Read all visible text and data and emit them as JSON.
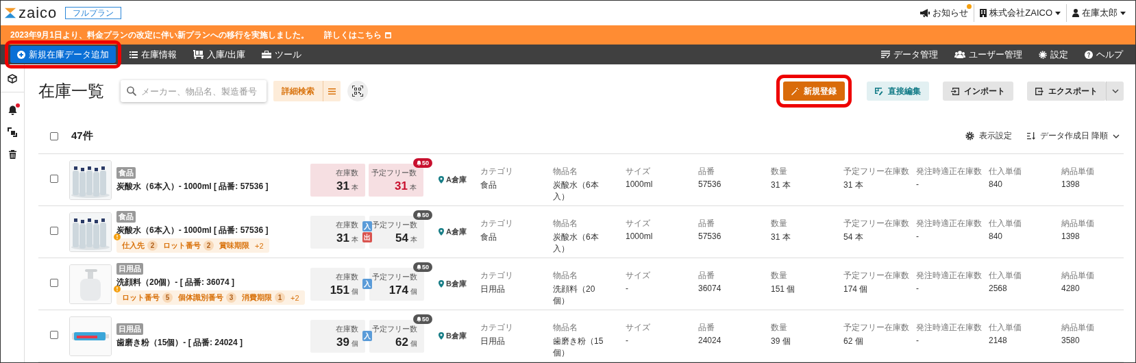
{
  "header": {
    "logo": "zaico",
    "plan_badge": "フルプラン",
    "notice": {
      "label": "お知らせ",
      "unread": true
    },
    "company": "株式会社ZAICO",
    "user": "在庫太郎"
  },
  "banner": {
    "message": "2023年9月1日より、料金プランの改定に伴い新プランへの移行を実施しました。",
    "link": "詳しくはこちら"
  },
  "nav": {
    "add_button": {
      "label": "新規在庫データ追加",
      "highlighted": true
    },
    "left_items": [
      "在庫情報",
      "入庫/出庫",
      "ツール"
    ],
    "right_items": [
      "データ管理",
      "ユーザー管理",
      "設定",
      "ヘルプ"
    ]
  },
  "sidebar": {
    "notifications_unread": true
  },
  "page": {
    "title": "在庫一覧",
    "search": {
      "placeholder": "メーカー、物品名、製造番号"
    },
    "advanced_search": "詳細検索",
    "actions": [
      {
        "label": "新規登録",
        "kind": "primary",
        "highlighted": true
      },
      {
        "label": "直接編集",
        "kind": "secondary",
        "highlighted": false
      },
      {
        "label": "インポート",
        "kind": "default",
        "highlighted": false
      },
      {
        "label": "エクスポート",
        "kind": "split",
        "highlighted": false
      }
    ]
  },
  "list_header": {
    "select_all_checked": false,
    "count": "47件",
    "display_settings": "表示設定",
    "sort": "データ作成日 降順"
  },
  "rows": [
    {
      "checked": false,
      "image": {
        "kind": "picture"
      },
      "category_tag": "食品",
      "title": "炭酸水（6本入）- 1000ml [ 品番: 57536 ]",
      "warnings": [],
      "alert": true,
      "stock": {
        "label": "在庫数",
        "value": "31",
        "unit": "本"
      },
      "free_stock": {
        "label": "予定フリー数",
        "value": "31",
        "unit": "本"
      },
      "badge": "50",
      "io_tags": [],
      "location": "A倉庫",
      "fields": [
        {
          "label": "カテゴリ",
          "value": "食品"
        },
        {
          "label": "物品名",
          "value": "炭酸水（6本入）"
        },
        {
          "label": "サイズ",
          "value": "1000ml"
        },
        {
          "label": "品番",
          "value": "57536"
        },
        {
          "label": "数量",
          "value": "31 本"
        },
        {
          "label": "予定フリー在庫数",
          "value": "31 本"
        },
        {
          "label": "発注時適正在庫数",
          "value": "-"
        },
        {
          "label": "仕入単価",
          "value": "840"
        },
        {
          "label": "納品単価",
          "value": "1398"
        }
      ]
    },
    {
      "checked": false,
      "image": {
        "kind": "picture"
      },
      "category_tag": "食品",
      "title": "炭酸水（6本入）- 1000ml [ 品番: 57536 ]",
      "warnings": [
        {
          "label": "仕入先",
          "count": "2"
        },
        {
          "label": "ロット番号",
          "count": "2"
        },
        {
          "label": "賞味期限"
        }
      ],
      "more": "+2",
      "alert": false,
      "stock": {
        "label": "在庫数",
        "value": "31",
        "unit": "本"
      },
      "free_stock": {
        "label": "予定フリー数",
        "value": "54",
        "unit": "本"
      },
      "badge": "50",
      "io_tags": [
        {
          "label": "入",
          "kind": "in"
        },
        {
          "label": "出",
          "kind": "out"
        }
      ],
      "location": "A倉庫",
      "fields": [
        {
          "label": "カテゴリ",
          "value": "食品"
        },
        {
          "label": "物品名",
          "value": "炭酸水（6本入）"
        },
        {
          "label": "サイズ",
          "value": "1000ml"
        },
        {
          "label": "品番",
          "value": "57536"
        },
        {
          "label": "数量",
          "value": "31 本"
        },
        {
          "label": "予定フリー在庫数",
          "value": "54 本"
        },
        {
          "label": "発注時適正在庫数",
          "value": "-"
        },
        {
          "label": "仕入単価",
          "value": "840"
        },
        {
          "label": "納品単価",
          "value": "1398"
        }
      ]
    },
    {
      "checked": false,
      "image": {
        "kind": "picture"
      },
      "category_tag": "日用品",
      "title": "洗顔料（20個）- [ 品番: 36074 ]",
      "warnings": [
        {
          "label": "ロット番号",
          "count": "5"
        },
        {
          "label": "個体識別番号",
          "count": "3"
        },
        {
          "label": "消費期限",
          "count": "1"
        }
      ],
      "more": "+2",
      "alert": false,
      "stock": {
        "label": "在庫数",
        "value": "151",
        "unit": "個"
      },
      "free_stock": {
        "label": "予定フリー数",
        "value": "174",
        "unit": "個"
      },
      "badge": "50",
      "io_tags": [
        {
          "label": "入",
          "kind": "in"
        }
      ],
      "location": "B倉庫",
      "fields": [
        {
          "label": "カテゴリ",
          "value": "日用品"
        },
        {
          "label": "物品名",
          "value": "洗顔料（20個）"
        },
        {
          "label": "サイズ",
          "value": "-"
        },
        {
          "label": "品番",
          "value": "36074"
        },
        {
          "label": "数量",
          "value": "151 個"
        },
        {
          "label": "予定フリー在庫数",
          "value": "174 個"
        },
        {
          "label": "発注時適正在庫数",
          "value": "-"
        },
        {
          "label": "仕入単価",
          "value": "2568"
        },
        {
          "label": "納品単価",
          "value": "4280"
        }
      ]
    },
    {
      "checked": false,
      "image": {
        "kind": "picture"
      },
      "category_tag": "日用品",
      "title": "歯磨き粉（15個）- [ 品番: 24024 ]",
      "warnings": [],
      "alert": false,
      "stock": {
        "label": "在庫数",
        "value": "39",
        "unit": "個"
      },
      "free_stock": {
        "label": "予定フリー数",
        "value": "62",
        "unit": "個"
      },
      "badge": "50",
      "io_tags": [
        {
          "label": "入",
          "kind": "in"
        }
      ],
      "location": "B倉庫",
      "fields": [
        {
          "label": "カテゴリ",
          "value": "日用品"
        },
        {
          "label": "物品名",
          "value": "歯磨き粉（15個）"
        },
        {
          "label": "サイズ",
          "value": "-"
        },
        {
          "label": "品番",
          "value": "24024"
        },
        {
          "label": "数量",
          "value": "39 個"
        },
        {
          "label": "予定フリー在庫数",
          "value": "62 個"
        },
        {
          "label": "発注時適正在庫数",
          "value": "-"
        },
        {
          "label": "仕入単価",
          "value": "2148"
        },
        {
          "label": "納品単価",
          "value": "3580"
        }
      ]
    }
  ]
}
